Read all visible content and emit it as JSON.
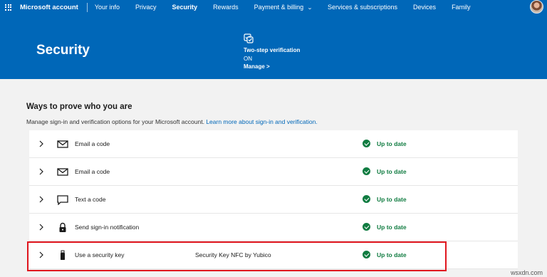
{
  "topnav": {
    "brand": "Microsoft account",
    "items": [
      {
        "label": "Your info"
      },
      {
        "label": "Privacy"
      },
      {
        "label": "Security"
      },
      {
        "label": "Rewards"
      },
      {
        "label": "Payment & billing"
      },
      {
        "label": "Services & subscriptions"
      },
      {
        "label": "Devices"
      },
      {
        "label": "Family"
      }
    ],
    "active": "Security"
  },
  "hero": {
    "title": "Security",
    "two_step": {
      "title": "Two-step verification",
      "status": "ON",
      "link": "Manage >"
    }
  },
  "main": {
    "title": "Ways to prove who you are",
    "description": "Manage sign-in and verification options for your Microsoft account.",
    "learn_more": "Learn more about sign-in and verification.",
    "methods": [
      {
        "icon": "mail-icon",
        "label": "Email a code",
        "detail": "",
        "status": "Up to date"
      },
      {
        "icon": "mail-icon",
        "label": "Email a code",
        "detail": "",
        "status": "Up to date"
      },
      {
        "icon": "message-icon",
        "label": "Text a code",
        "detail": "",
        "status": "Up to date"
      },
      {
        "icon": "lock-icon",
        "label": "Send sign-in notification",
        "detail": "",
        "status": "Up to date"
      },
      {
        "icon": "usb-key-icon",
        "label": "Use a security key",
        "detail": "Security Key NFC by Yubico",
        "status": "Up to date"
      }
    ]
  },
  "colors": {
    "brand_blue": "#0067b8",
    "status_green": "#107c41",
    "highlight_red": "#e0161e"
  },
  "watermark": "wsxdn.com"
}
